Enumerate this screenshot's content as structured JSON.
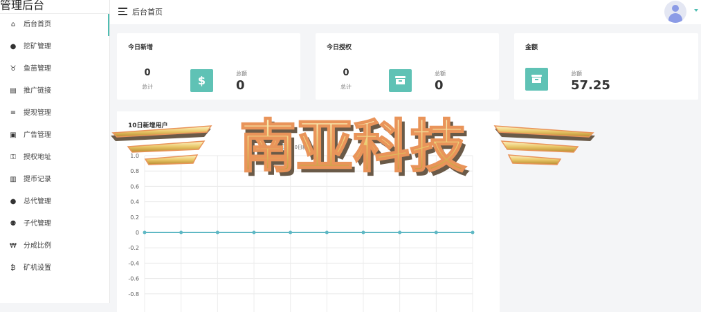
{
  "app": {
    "title": "管理后台"
  },
  "sidebar": {
    "items": [
      {
        "label": "后台首页",
        "icon": "home-icon",
        "glyph": "⌂"
      },
      {
        "label": "挖矿管理",
        "icon": "user-icon",
        "glyph": "●"
      },
      {
        "label": "鱼苗管理",
        "icon": "fish-icon",
        "glyph": "♉"
      },
      {
        "label": "推广链接",
        "icon": "file-icon",
        "glyph": "▤"
      },
      {
        "label": "提现管理",
        "icon": "list-icon",
        "glyph": "≡"
      },
      {
        "label": "广告管理",
        "icon": "ad-icon",
        "glyph": "▣"
      },
      {
        "label": "授权地址",
        "icon": "key-icon",
        "glyph": "⚿"
      },
      {
        "label": "提币记录",
        "icon": "record-icon",
        "glyph": "▥"
      },
      {
        "label": "总代管理",
        "icon": "user-icon",
        "glyph": "●"
      },
      {
        "label": "子代管理",
        "icon": "group-icon",
        "glyph": "⚉"
      },
      {
        "label": "分成比例",
        "icon": "won-icon",
        "glyph": "₩"
      },
      {
        "label": "矿机设置",
        "icon": "bitcoin-icon",
        "glyph": "₿"
      }
    ]
  },
  "topbar": {
    "title": "后台首页",
    "menu_icon": "hamburger-icon",
    "avatar_icon": "avatar-icon"
  },
  "cards": {
    "new_users": {
      "title": "今日新增",
      "count": "0",
      "count_label": "总计",
      "sum_label": "总额",
      "sum": "0",
      "icon": "dollar-icon",
      "glyph": "$"
    },
    "auth": {
      "title": "今日授权",
      "count": "0",
      "count_label": "总计",
      "sum_label": "总额",
      "sum": "0",
      "icon": "archive-icon"
    },
    "amount": {
      "title": "金额",
      "sum_label": "总额",
      "sum": "57.25",
      "icon": "archive-icon"
    }
  },
  "chart_data": {
    "type": "line",
    "title": "10日新增用户",
    "series": [
      {
        "name": "10日新增用户",
        "values": [
          0,
          0,
          0,
          0,
          0,
          0,
          0,
          0,
          0,
          0
        ]
      }
    ],
    "ylim": [
      -0.8,
      1.0
    ],
    "yticks": [
      "1.0",
      "0.8",
      "0.6",
      "0.4",
      "0.2",
      "0",
      "-0.2",
      "-0.4",
      "-0.6",
      "-0.8"
    ],
    "ytick_values": [
      1.0,
      0.8,
      0.6,
      0.4,
      0.2,
      0,
      -0.2,
      -0.4,
      -0.6,
      -0.8
    ],
    "grid": true,
    "legend": "top",
    "color": "#5fb8c4"
  },
  "watermark": {
    "text": "南亚科技"
  }
}
